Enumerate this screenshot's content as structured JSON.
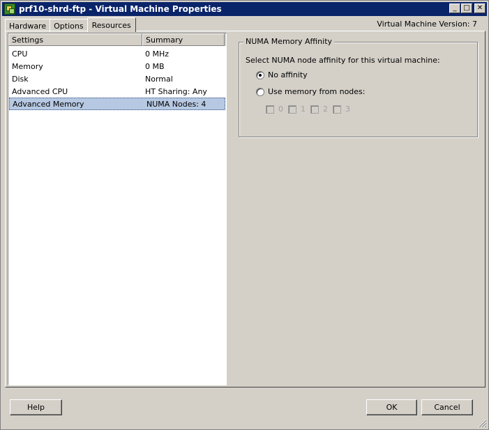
{
  "window": {
    "title": "prf10-shrd-ftp - Virtual Machine Properties",
    "vm_version": "Virtual Machine Version: 7",
    "title_buttons": {
      "minimize": "_",
      "maximize": "□",
      "close": "✕"
    }
  },
  "tabs": [
    {
      "label": "Hardware"
    },
    {
      "label": "Options"
    },
    {
      "label": "Resources",
      "active": true
    }
  ],
  "settings_table": {
    "headers": {
      "settings": "Settings",
      "summary": "Summary"
    },
    "rows": [
      {
        "setting": "CPU",
        "summary": "0 MHz"
      },
      {
        "setting": "Memory",
        "summary": "0 MB"
      },
      {
        "setting": "Disk",
        "summary": "Normal"
      },
      {
        "setting": "Advanced CPU",
        "summary": "HT Sharing: Any"
      },
      {
        "setting": "Advanced Memory",
        "summary": "NUMA Nodes: 4",
        "selected": true
      }
    ]
  },
  "numa": {
    "group_title": "NUMA Memory Affinity",
    "description": "Select NUMA node affinity for this virtual machine:",
    "options": [
      {
        "label": "No affinity",
        "selected": true
      },
      {
        "label": "Use memory from nodes:",
        "selected": false
      }
    ],
    "nodes": [
      "0",
      "1",
      "2",
      "3"
    ]
  },
  "buttons": {
    "help": "Help",
    "ok": "OK",
    "cancel": "Cancel"
  }
}
